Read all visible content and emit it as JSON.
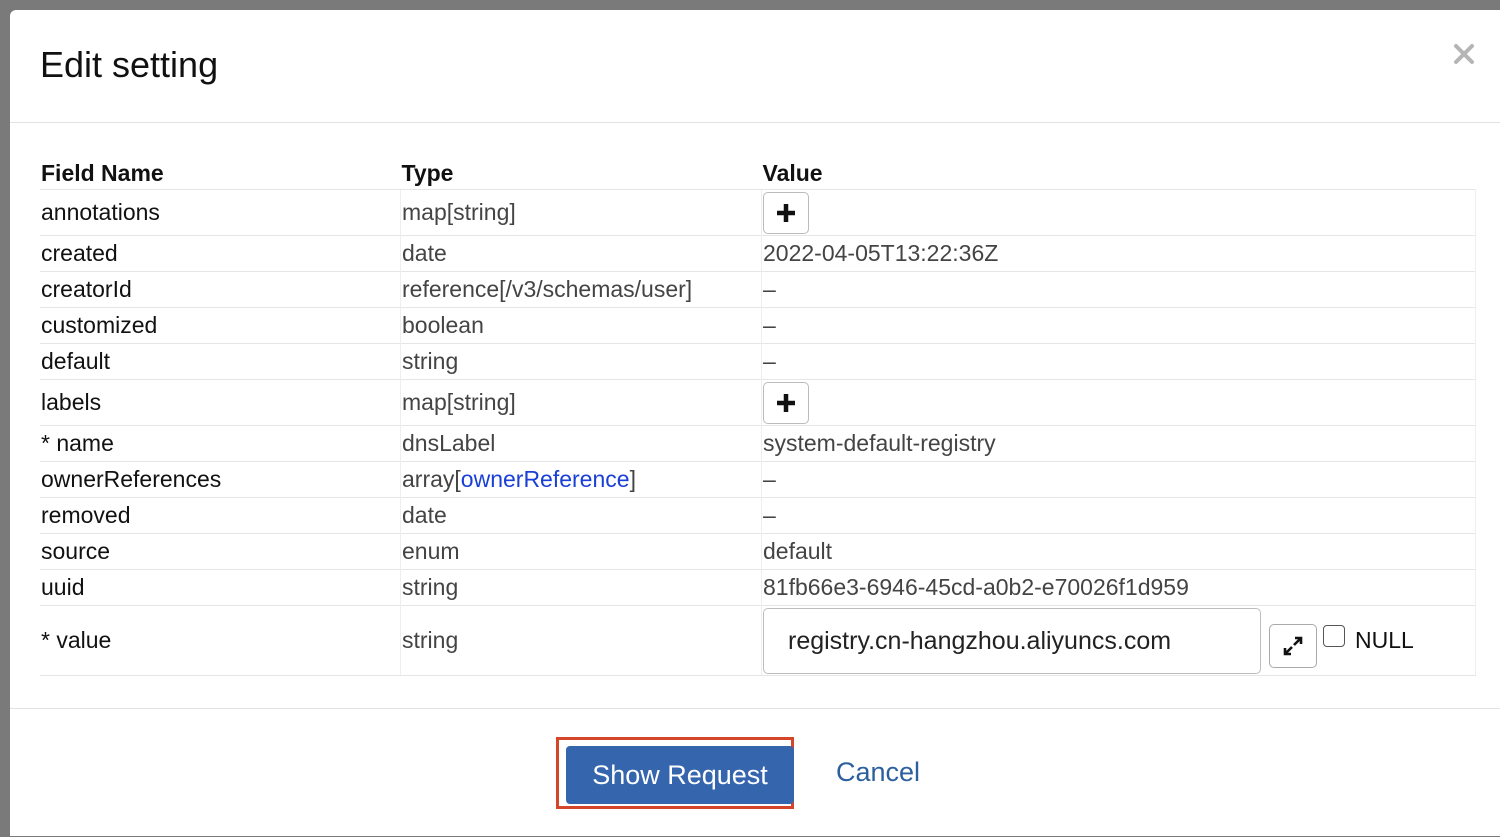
{
  "dialog": {
    "title": "Edit setting"
  },
  "table": {
    "headers": {
      "field": "Field Name",
      "type": "Type",
      "value": "Value"
    },
    "rows": [
      {
        "field": "annotations",
        "type": "map[string]",
        "value": ""
      },
      {
        "field": "created",
        "type": "date",
        "value": "2022-04-05T13:22:36Z"
      },
      {
        "field": "creatorId",
        "type": "reference[/v3/schemas/user]",
        "value": "–"
      },
      {
        "field": "customized",
        "type": "boolean",
        "value": "–"
      },
      {
        "field": "default",
        "type": "string",
        "value": "–"
      },
      {
        "field": "labels",
        "type": "map[string]",
        "value": ""
      },
      {
        "field": "* name",
        "type": "dnsLabel",
        "value": "system-default-registry"
      },
      {
        "field": "ownerReferences",
        "type_prefix": "array[",
        "type_link": "ownerReference",
        "type_suffix": "]",
        "value": "–"
      },
      {
        "field": "removed",
        "type": "date",
        "value": "–"
      },
      {
        "field": "source",
        "type": "enum",
        "value": "default"
      },
      {
        "field": "uuid",
        "type": "string",
        "value": "81fb66e3-6946-45cd-a0b2-e70026f1d959"
      },
      {
        "field": "* value",
        "type": "string",
        "value": "registry.cn-hangzhou.aliyuncs.com",
        "null_label": "NULL"
      }
    ]
  },
  "footer": {
    "show_request": "Show Request",
    "cancel": "Cancel"
  },
  "colors": {
    "primary": "#3565ad",
    "highlight": "#d4452a",
    "link": "#1a3fd6"
  },
  "icons": {
    "close": "close-icon",
    "plus": "plus-icon",
    "expand": "expand-icon"
  }
}
